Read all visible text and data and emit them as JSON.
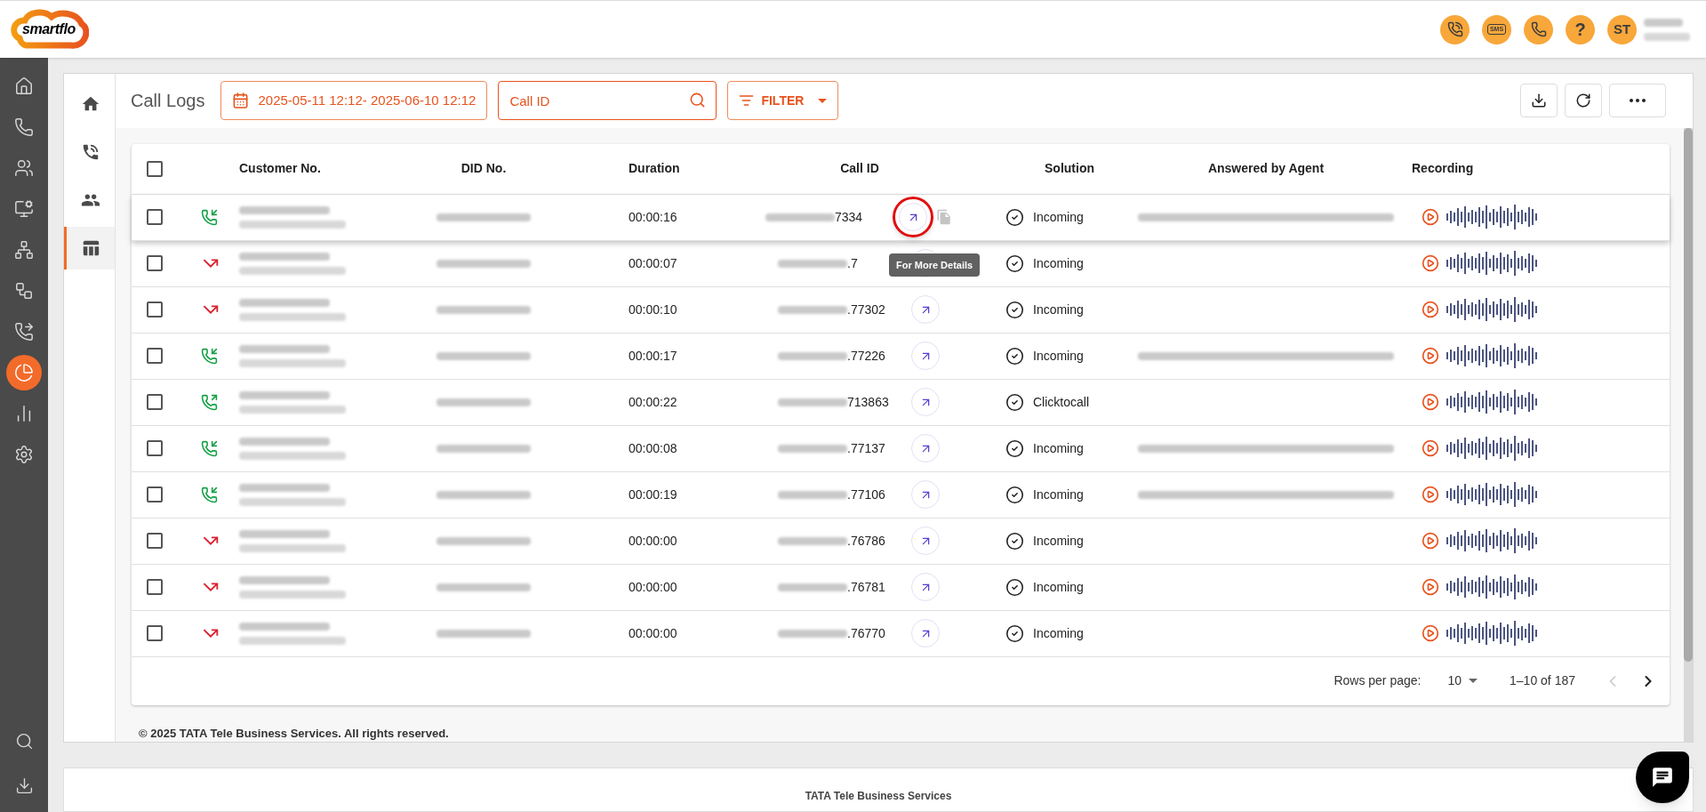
{
  "app": {
    "logo": "smartflo",
    "header_actions": [
      {
        "kind": "call"
      },
      {
        "kind": "sms",
        "label": "SMS"
      },
      {
        "kind": "call-history"
      },
      {
        "kind": "help",
        "label": "?"
      }
    ],
    "user_initials": "ST"
  },
  "sidebar": {
    "items": [
      {
        "kind": "home",
        "selected": false
      },
      {
        "kind": "phone",
        "selected": false
      },
      {
        "kind": "users",
        "selected": false
      },
      {
        "kind": "monitor",
        "selected": false
      },
      {
        "kind": "network",
        "selected": false
      },
      {
        "kind": "workflow",
        "selected": false
      },
      {
        "kind": "transfer",
        "selected": false
      },
      {
        "kind": "reports",
        "selected": true
      },
      {
        "kind": "analytics",
        "selected": false
      },
      {
        "kind": "settings",
        "selected": false
      }
    ],
    "bottom_items": [
      {
        "kind": "search"
      },
      {
        "kind": "download"
      }
    ]
  },
  "subnav": {
    "items": [
      {
        "kind": "home",
        "selected": false
      },
      {
        "kind": "calls",
        "selected": false
      },
      {
        "kind": "contacts",
        "selected": false
      },
      {
        "kind": "table",
        "selected": true
      }
    ]
  },
  "page": {
    "title": "Call Logs",
    "date_range": "2025-05-11 12:12- 2025-06-10 12:12",
    "search": {
      "placeholder": "Call ID"
    },
    "filter_label": "FILTER"
  },
  "table": {
    "select_all_checked": false,
    "columns": [
      "Customer No.",
      "DID No.",
      "Duration",
      "Call ID",
      "Solution",
      "Answered by Agent",
      "Recording"
    ],
    "rows": [
      {
        "checked": false,
        "kind": "incoming",
        "duration": "00:00:16",
        "call_id": "7334",
        "solution": "Incoming",
        "agent_shown": true,
        "hovered": true,
        "annotated": true,
        "tooltip": "For More Details"
      },
      {
        "checked": false,
        "kind": "missed",
        "duration": "00:00:07",
        "call_id": ".7",
        "solution": "Incoming",
        "agent_shown": false,
        "hovered": false,
        "annotated": false
      },
      {
        "checked": false,
        "kind": "missed",
        "duration": "00:00:10",
        "call_id": ".77302",
        "solution": "Incoming",
        "agent_shown": false,
        "hovered": false,
        "annotated": false
      },
      {
        "checked": false,
        "kind": "incoming",
        "duration": "00:00:17",
        "call_id": ".77226",
        "solution": "Incoming",
        "agent_shown": true,
        "hovered": false,
        "annotated": false
      },
      {
        "checked": false,
        "kind": "outgoing",
        "duration": "00:00:22",
        "call_id": "713863",
        "solution": "Clicktocall",
        "agent_shown": false,
        "hovered": false,
        "annotated": false
      },
      {
        "checked": false,
        "kind": "incoming",
        "duration": "00:00:08",
        "call_id": ".77137",
        "solution": "Incoming",
        "agent_shown": true,
        "hovered": false,
        "annotated": false
      },
      {
        "checked": false,
        "kind": "incoming",
        "duration": "00:00:19",
        "call_id": ".77106",
        "solution": "Incoming",
        "agent_shown": true,
        "hovered": false,
        "annotated": false
      },
      {
        "checked": false,
        "kind": "missed",
        "duration": "00:00:00",
        "call_id": ".76786",
        "solution": "Incoming",
        "agent_shown": false,
        "hovered": false,
        "annotated": false
      },
      {
        "checked": false,
        "kind": "missed",
        "duration": "00:00:00",
        "call_id": ".76781",
        "solution": "Incoming",
        "agent_shown": false,
        "hovered": false,
        "annotated": false
      },
      {
        "checked": false,
        "kind": "missed",
        "duration": "00:00:00",
        "call_id": ".76770",
        "solution": "Incoming",
        "agent_shown": false,
        "hovered": false,
        "annotated": false
      }
    ],
    "pagination": {
      "rows_per_page_label": "Rows per page:",
      "rows_per_page": "10",
      "range": "1–10 of 187",
      "prev_disabled": true
    }
  },
  "footer": {
    "copyright": "© 2025 TATA Tele Business Services. All rights reserved.",
    "company": "TATA Tele Business Services"
  }
}
